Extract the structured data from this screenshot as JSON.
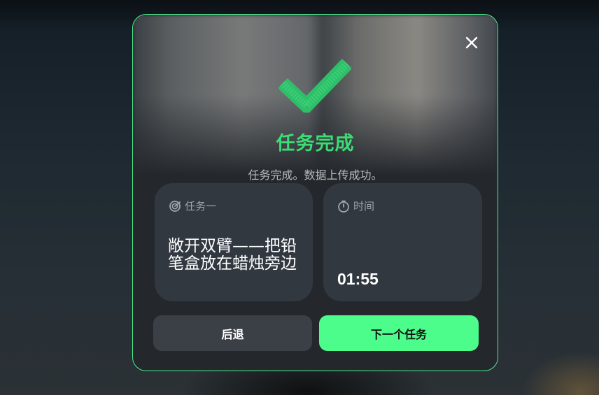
{
  "modal": {
    "title": "任务完成",
    "subtitle": "任务完成。数据上传成功。",
    "close_icon": "close-icon",
    "status_icon": "checkmark-icon"
  },
  "task_card": {
    "label": "任务一",
    "icon": "target-icon",
    "description": "敞开双臂——把铅笔盒放在蜡烛旁边"
  },
  "time_card": {
    "label": "时间",
    "icon": "stopwatch-icon",
    "value": "01:55"
  },
  "buttons": {
    "back_label": "后退",
    "next_label": "下一个任务"
  },
  "colors": {
    "accent": "#4dfd8b",
    "title_green": "#3cdc74",
    "modal_bg": "#24282d",
    "card_bg": "#323840"
  }
}
